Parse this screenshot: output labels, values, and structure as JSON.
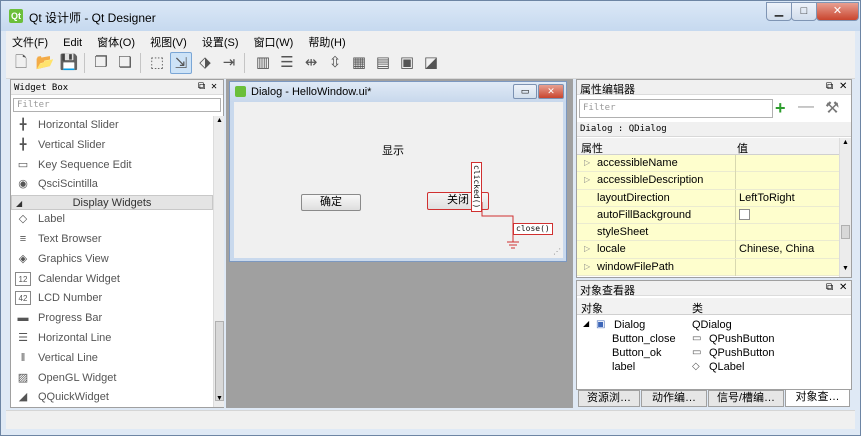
{
  "window": {
    "title": "Qt 设计师 - Qt Designer",
    "icon": "qt-app-icon"
  },
  "menubar": [
    "文件(F)",
    "Edit",
    "窗体(O)",
    "视图(V)",
    "设置(S)",
    "窗口(W)",
    "帮助(H)"
  ],
  "widget_box": {
    "title": "Widget Box",
    "filter_placeholder": "Filter",
    "items_top": [
      {
        "label": "Horizontal Slider",
        "icon": "horizontal-slider-icon",
        "glyph": "╋"
      },
      {
        "label": "Vertical Slider",
        "icon": "vertical-slider-icon",
        "glyph": "╋"
      },
      {
        "label": "Key Sequence Edit",
        "icon": "key-sequence-icon",
        "glyph": "▭"
      },
      {
        "label": "QsciScintilla",
        "icon": "qsci-icon",
        "glyph": "◉"
      }
    ],
    "category": "Display Widgets",
    "items_bottom": [
      {
        "label": "Label",
        "icon": "label-icon",
        "glyph": "◇"
      },
      {
        "label": "Text Browser",
        "icon": "text-browser-icon",
        "glyph": "≡"
      },
      {
        "label": "Graphics View",
        "icon": "graphics-view-icon",
        "glyph": "◈"
      },
      {
        "label": "Calendar Widget",
        "icon": "calendar-icon",
        "glyph": "12"
      },
      {
        "label": "LCD Number",
        "icon": "lcd-number-icon",
        "glyph": "42"
      },
      {
        "label": "Progress Bar",
        "icon": "progress-bar-icon",
        "glyph": "▬"
      },
      {
        "label": "Horizontal Line",
        "icon": "horizontal-line-icon",
        "glyph": "☰"
      },
      {
        "label": "Vertical Line",
        "icon": "vertical-line-icon",
        "glyph": "‖"
      },
      {
        "label": "OpenGL Widget",
        "icon": "opengl-icon",
        "glyph": "▨"
      },
      {
        "label": "QQuickWidget",
        "icon": "qquick-icon",
        "glyph": "◢"
      }
    ]
  },
  "form": {
    "title": "Dialog - HelloWindow.ui*",
    "label_text": "显示",
    "ok_button": "确定",
    "close_button": "关闭",
    "signal_vertical": "clicked()",
    "slot_horizontal": "close()"
  },
  "property_editor": {
    "title": "属性编辑器",
    "filter_placeholder": "Filter",
    "object": "Dialog : QDialog",
    "col_property": "属性",
    "col_value": "值",
    "rows": [
      {
        "name": "accessibleName",
        "value": "",
        "expandable": true
      },
      {
        "name": "accessibleDescription",
        "value": "",
        "expandable": true
      },
      {
        "name": "layoutDirection",
        "value": "LeftToRight",
        "expandable": false
      },
      {
        "name": "autoFillBackground",
        "value": "",
        "expandable": false
      },
      {
        "name": "styleSheet",
        "value": "",
        "expandable": false
      },
      {
        "name": "locale",
        "value": "Chinese, China",
        "expandable": true
      },
      {
        "name": "windowFilePath",
        "value": "",
        "expandable": true
      }
    ]
  },
  "object_inspector": {
    "title": "对象查看器",
    "col_object": "对象",
    "col_class": "类",
    "rows": [
      {
        "object": "Dialog",
        "class": "QDialog"
      },
      {
        "object": "Button_close",
        "class": "QPushButton"
      },
      {
        "object": "Button_ok",
        "class": "QPushButton"
      },
      {
        "object": "label",
        "class": "QLabel"
      }
    ]
  },
  "bottom_tabs": [
    "资源浏…",
    "动作编…",
    "信号/槽编…",
    "对象查…"
  ],
  "colors": {
    "selection_red": "#d03030",
    "property_row_bg": "#fefecd",
    "titlebar": "#c6d9ef"
  }
}
